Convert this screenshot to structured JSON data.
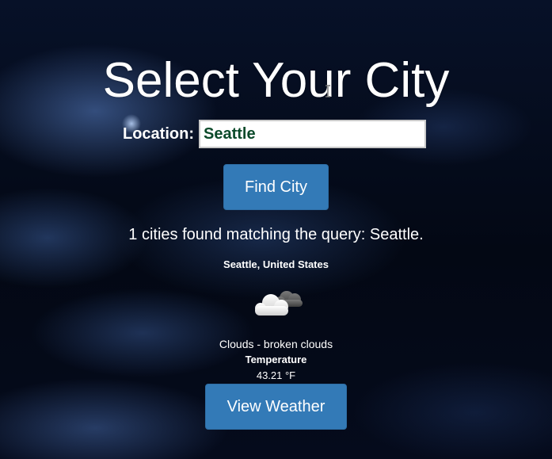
{
  "header": {
    "title": "Select Your City"
  },
  "search": {
    "location_label": "Location:",
    "location_value": "Seattle",
    "find_button_label": "Find City"
  },
  "results": {
    "summary": "1 cities found matching the query: Seattle.",
    "city": {
      "name": "Seattle, United States",
      "weather_icon": "broken-clouds-icon",
      "description": "Clouds - broken clouds",
      "temperature_label": "Temperature",
      "temperature_value": "43.21 °F"
    },
    "view_button_label": "View Weather"
  },
  "colors": {
    "button": "#337ab7",
    "input_text": "#0b4a2a",
    "text": "#ffffff"
  }
}
